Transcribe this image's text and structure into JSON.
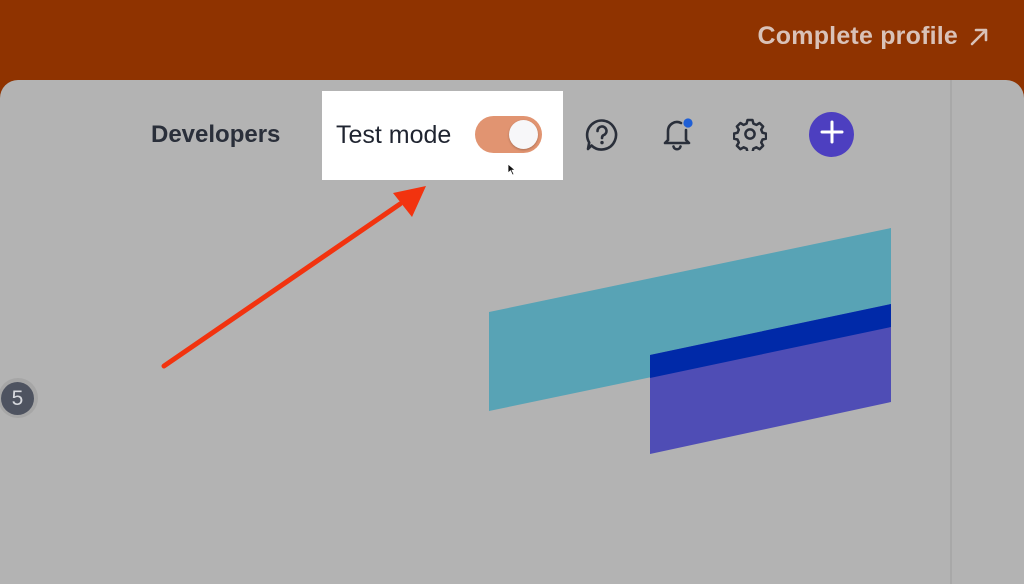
{
  "banner": {
    "cta_label": "Complete profile",
    "cta_icon": "arrow-up-right-icon",
    "background": "#8f3300"
  },
  "header": {
    "developers_label": "Developers",
    "test_mode_label": "Test mode",
    "test_mode_enabled": true,
    "help_icon": "question-circle-icon",
    "notifications_icon": "bell-icon",
    "notification_dot_color": "#1f5fd6",
    "settings_icon": "gear-icon",
    "create_icon": "plus-icon",
    "create_button_color": "#4d3fc0",
    "toggle_color": "#e19471"
  },
  "side": {
    "badge_count": "5"
  },
  "annotation": {
    "arrow_color": "#f2330f"
  }
}
